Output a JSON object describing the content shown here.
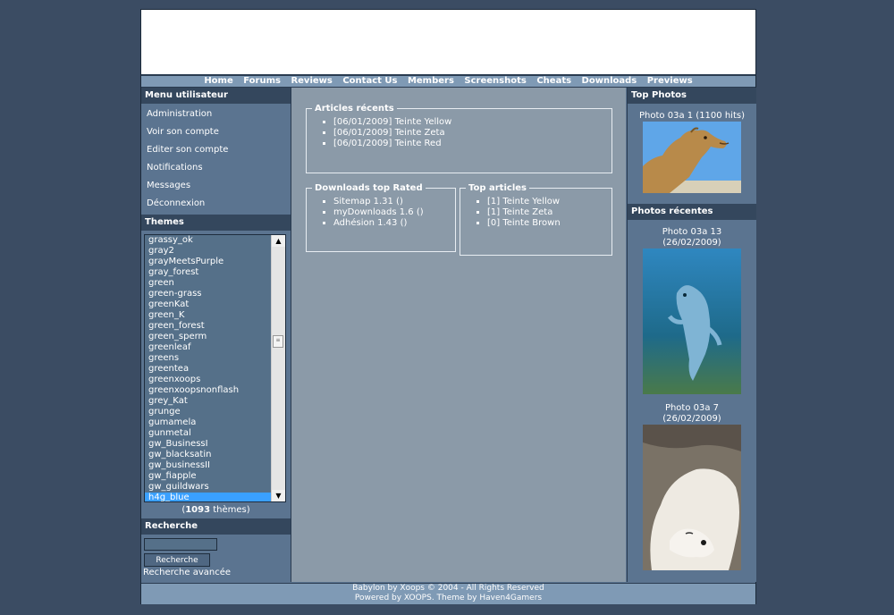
{
  "nav": [
    "Home",
    "Forums",
    "Reviews",
    "Contact Us",
    "Members",
    "Screenshots",
    "Cheats",
    "Downloads",
    "Previews"
  ],
  "user_menu": {
    "title": "Menu utilisateur",
    "items": [
      "Administration",
      "Voir son compte",
      "Editer son compte",
      "Notifications",
      "Messages",
      "Déconnexion"
    ]
  },
  "themes": {
    "title": "Themes",
    "list": [
      "grassy_ok",
      "gray2",
      "grayMeetsPurple",
      "gray_forest",
      "green",
      "green-grass",
      "greenKat",
      "green_K",
      "green_forest",
      "green_sperm",
      "greenleaf",
      "greens",
      "greentea",
      "greenxoops",
      "greenxoopsnonflash",
      "grey_Kat",
      "grunge",
      "gumamela",
      "gunmetal",
      "gw_BusinessI",
      "gw_blacksatin",
      "gw_businessII",
      "gw_fiapple",
      "gw_guildwars",
      "h4g_blue"
    ],
    "selected": "h4g_blue",
    "count_prefix": "(",
    "count": "1093",
    "count_suffix": " thèmes)"
  },
  "search": {
    "title": "Recherche",
    "input_value": "",
    "button_label": "Recherche",
    "advanced_link": "Recherche avancée"
  },
  "articles_recents": {
    "title": "Articles récents",
    "items": [
      "[06/01/2009] Teinte Yellow",
      "[06/01/2009] Teinte Zeta",
      "[06/01/2009] Teinte Red"
    ]
  },
  "downloads_top": {
    "title": "Downloads top Rated",
    "items": [
      "Sitemap 1.31 ()",
      "myDownloads 1.6 ()",
      "Adhésion 1.43 ()"
    ]
  },
  "top_articles": {
    "title": "Top articles",
    "items": [
      "[1] Teinte Yellow",
      "[1] Teinte Zeta",
      "[0] Teinte Brown"
    ]
  },
  "top_photos": {
    "title": "Top Photos",
    "items": [
      {
        "caption": "Photo 03a 1 (1100 hits)",
        "subject": "camel"
      }
    ]
  },
  "recent_photos": {
    "title": "Photos récentes",
    "items": [
      {
        "caption": "Photo 03a 13 (26/02/2009)",
        "subject": "dolphin"
      },
      {
        "caption": "Photo 03a 7 (26/02/2009)",
        "subject": "polar-bear"
      }
    ]
  },
  "footer": {
    "line1": "Babylon by Xoops © 2004 - All Rights Reserved",
    "line2": "Powered by XOOPS. Theme by Haven4Gamers"
  },
  "colors": {
    "background": "#3b4c63",
    "panel": "#5b7490",
    "block_header": "#34475d",
    "center": "#8b9aa8",
    "navbar": "#7f9ab5",
    "selection": "#3aa0ff"
  }
}
